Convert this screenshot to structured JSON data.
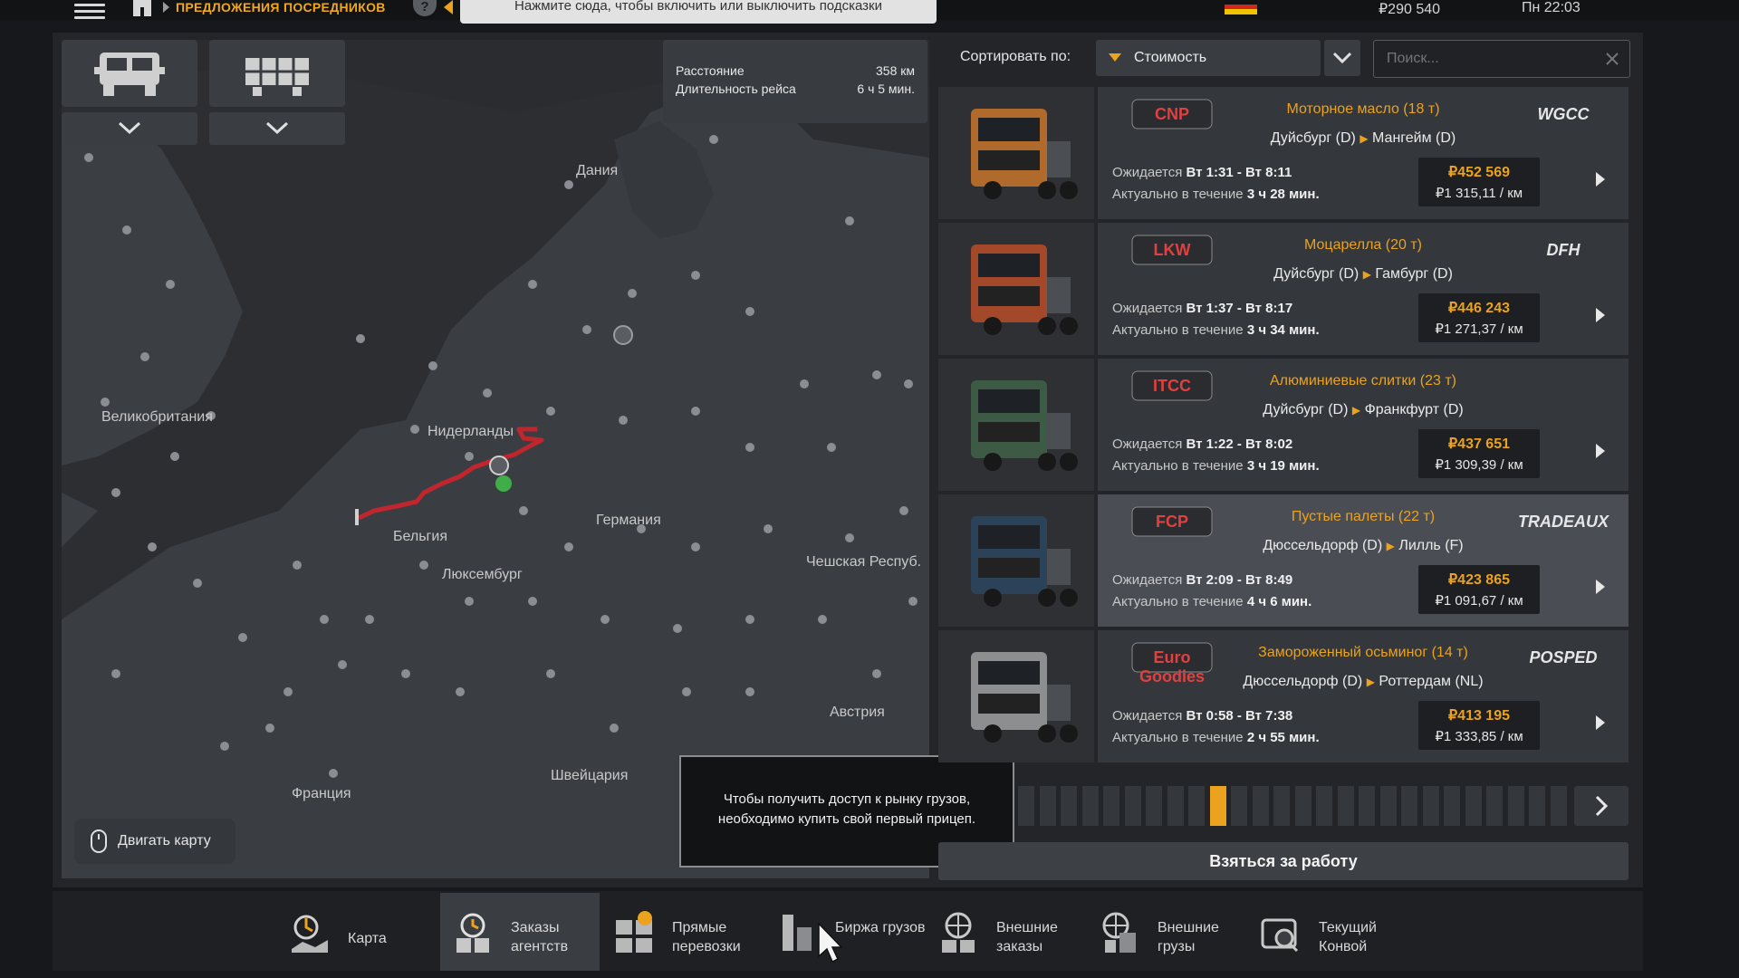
{
  "topbar": {
    "breadcrumb": "ПРЕДЛОЖЕНИЯ ПОСРЕДНИКОВ",
    "help_label": "?",
    "hint_text": "Нажмите сюда, чтобы включить или выключить подсказки",
    "money": "₽290 540",
    "clock": "Пн 22:03"
  },
  "route_info": {
    "distance_label": "Расстояние",
    "distance_value": "358 км",
    "duration_label": "Длительность рейса",
    "duration_value": "6 ч 5 мин."
  },
  "map": {
    "labels": {
      "denmark": "Дания",
      "uk": "Великобритания",
      "netherlands": "Нидерланды",
      "germany": "Германия",
      "belgium": "Бельгия",
      "luxembourg": "Люксембург",
      "czech": "Чешская Респуб.",
      "austria": "Австрия",
      "switzerland": "Швейцария",
      "france": "Франция"
    },
    "move_map_label": "Двигать карту"
  },
  "tooltip": {
    "text": "Чтобы получить доступ к рынку грузов, необходимо купить свой первый прицеп."
  },
  "sort": {
    "label": "Сортировать по:",
    "selected": "Стоимость"
  },
  "search": {
    "placeholder": "Поиск..."
  },
  "jobs": [
    {
      "cargo": "Моторное масло (18 т)",
      "from": "Дуйсбург (D)",
      "to": "Мангейм (D)",
      "expected_label": "Ожидается",
      "expected": "Вт 1:31 - Вт 8:11",
      "valid_label": "Актуально в течение",
      "valid": "3 ч 28 мин.",
      "price": "₽452 569",
      "per_km": "₽1 315,11 / км",
      "logo_left": "CNP",
      "logo_right": "WGCC",
      "truck_color": "#b06a2c"
    },
    {
      "cargo": "Моцарелла (20 т)",
      "from": "Дуйсбург (D)",
      "to": "Гамбург (D)",
      "expected_label": "Ожидается",
      "expected": "Вт 1:37 - Вт 8:17",
      "valid_label": "Актуально в течение",
      "valid": "3 ч 34 мин.",
      "price": "₽446 243",
      "per_km": "₽1 271,37 / км",
      "logo_left": "LKW",
      "logo_right": "DFH",
      "truck_color": "#a3492a"
    },
    {
      "cargo": "Алюминиевые слитки (23 т)",
      "from": "Дуйсбург (D)",
      "to": "Франкфурт (D)",
      "expected_label": "Ожидается",
      "expected": "Вт 1:22 - Вт 8:02",
      "valid_label": "Актуально в течение",
      "valid": "3 ч 19 мин.",
      "price": "₽437 651",
      "per_km": "₽1 309,39 / км",
      "logo_left": "ITCC",
      "logo_right": "",
      "truck_color": "#3c5a44"
    },
    {
      "cargo": "Пустые палеты (22 т)",
      "from": "Дюссельдорф (D)",
      "to": "Лилль (F)",
      "expected_label": "Ожидается",
      "expected": "Вт 2:09 - Вт 8:49",
      "valid_label": "Актуально в течение",
      "valid": "4 ч 6 мин.",
      "price": "₽423 865",
      "per_km": "₽1 091,67 / км",
      "logo_left": "FCP",
      "logo_right": "TRADEAUX",
      "truck_color": "#2c4258"
    },
    {
      "cargo": "Замороженный осьминог (14 т)",
      "from": "Дюссельдорф (D)",
      "to": "Роттердам (NL)",
      "expected_label": "Ожидается",
      "expected": "Вт 0:58 - Вт 7:38",
      "valid_label": "Актуально в течение",
      "valid": "2 ч 55 мин.",
      "price": "₽413 195",
      "per_km": "₽1 333,85 / км",
      "logo_left": "Euro Goodies",
      "logo_right": "POSPED",
      "truck_color": "#8c8e90"
    }
  ],
  "pager": {
    "active_index": 9
  },
  "take_job_label": "Взяться за работу",
  "bottom_nav": [
    {
      "label": "Карта",
      "icon": "map-pin-icon"
    },
    {
      "label": "Заказы агентств",
      "icon": "clock-agency-icon"
    },
    {
      "label": "Прямые перевозки",
      "icon": "direct-freight-icon"
    },
    {
      "label": "Биржа грузов",
      "icon": "freight-market-icon"
    },
    {
      "label": "Внешние заказы",
      "icon": "globe-contracts-icon"
    },
    {
      "label": "Внешние грузы",
      "icon": "globe-cargo-icon"
    },
    {
      "label": "Текущий Конвой",
      "icon": "convoy-icon"
    }
  ],
  "colors": {
    "accent": "#eaa21f",
    "route": "#c0262d"
  }
}
